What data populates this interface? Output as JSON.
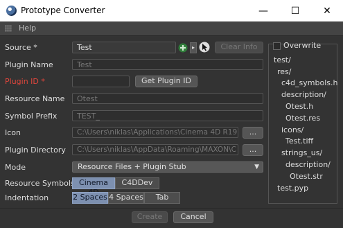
{
  "window": {
    "title": "Prototype Converter",
    "minimize": "—",
    "maximize": "☐",
    "close": "✕"
  },
  "menu": {
    "help": "Help"
  },
  "form": {
    "source": {
      "label": "Source *",
      "value": "Test",
      "clear_info": "Clear Info"
    },
    "plugin_name": {
      "label": "Plugin Name",
      "placeholder": "Test"
    },
    "plugin_id": {
      "label": "Plugin ID *",
      "value": "",
      "get_button": "Get Plugin ID"
    },
    "resource_name": {
      "label": "Resource Name",
      "placeholder": "Otest"
    },
    "symbol_prefix": {
      "label": "Symbol Prefix",
      "placeholder": "TEST_"
    },
    "icon": {
      "label": "Icon",
      "value": "C:\\Users\\niklas\\Applications\\Cinema 4D R19",
      "browse": "..."
    },
    "plugin_directory": {
      "label": "Plugin Directory",
      "value": "C:\\Users\\niklas\\AppData\\Roaming\\MAXON\\C",
      "browse": "..."
    },
    "mode": {
      "label": "Mode",
      "selected": "Resource Files + Plugin Stub"
    },
    "resource_symbols": {
      "label": "Resource Symbols",
      "options": [
        "Cinema 4D",
        "C4DDev"
      ],
      "selected_index": 0
    },
    "indentation": {
      "label": "Indentation",
      "options": [
        "2 Spaces",
        "4 Spaces",
        "Tab"
      ],
      "selected_index": 0
    }
  },
  "preview": {
    "overwrite_label": "Overwrite",
    "overwrite_checked": false,
    "tree": [
      "test/",
      "res/",
      "c4d_symbols.h",
      "description/",
      "Otest.h",
      "Otest.res",
      "icons/",
      "Test.tiff",
      "strings_us/",
      "description/",
      "Otest.str",
      "test.pyp"
    ]
  },
  "footer": {
    "create": "Create",
    "cancel": "Cancel"
  },
  "colors": {
    "required": "#e0463c",
    "segment_selected": "#7d90b0",
    "background": "#333333"
  },
  "icons": [
    "cinema4d-logo-icon",
    "grip-icon",
    "add-plus-icon",
    "arrow-right-icon",
    "pick-cursor-icon",
    "chevron-down-icon"
  ]
}
